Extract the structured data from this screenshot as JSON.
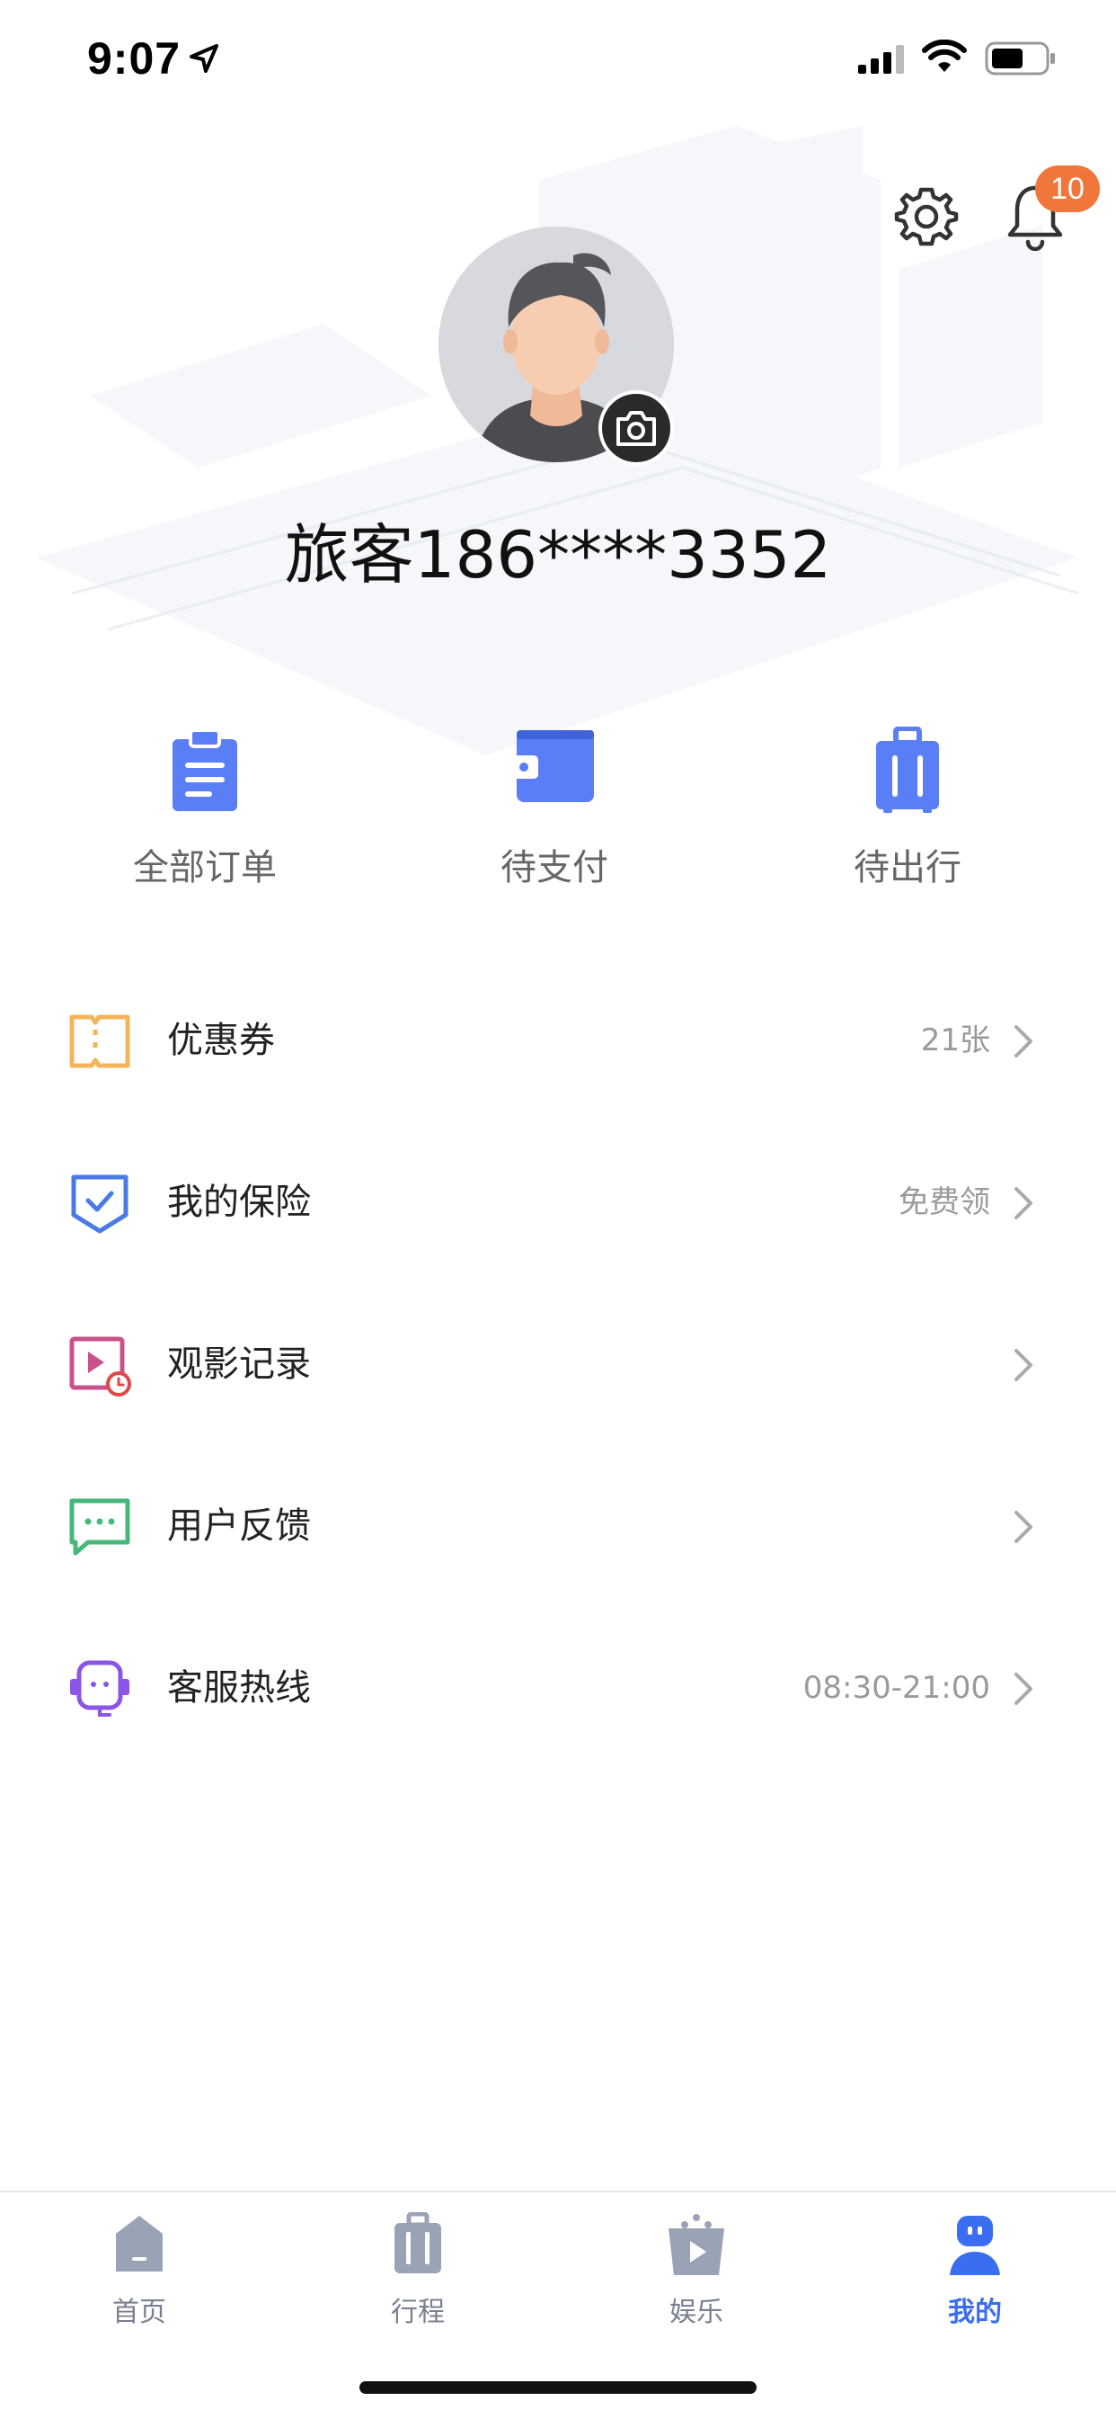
{
  "status_bar": {
    "time": "9:07"
  },
  "header": {
    "notification_count": "10"
  },
  "profile": {
    "username": "旅客186****3352"
  },
  "orders": [
    {
      "label": "全部订单",
      "icon": "clipboard-icon"
    },
    {
      "label": "待支付",
      "icon": "wallet-icon"
    },
    {
      "label": "待出行",
      "icon": "luggage-icon"
    }
  ],
  "menu": [
    {
      "label": "优惠券",
      "value": "21张",
      "icon": "coupon-icon"
    },
    {
      "label": "我的保险",
      "value": "免费领",
      "icon": "shield-icon"
    },
    {
      "label": "观影记录",
      "value": "",
      "icon": "video-history-icon"
    },
    {
      "label": "用户反馈",
      "value": "",
      "icon": "chat-icon"
    },
    {
      "label": "客服热线",
      "value": "08:30-21:00",
      "icon": "headset-icon"
    }
  ],
  "tabs": [
    {
      "label": "首页",
      "icon": "home-icon"
    },
    {
      "label": "行程",
      "icon": "trip-icon"
    },
    {
      "label": "娱乐",
      "icon": "entertainment-icon"
    },
    {
      "label": "我的",
      "icon": "profile-icon",
      "active": true
    }
  ],
  "colors": {
    "accent": "#3a6df0",
    "icon_blue": "#5a7ef5",
    "badge": "#f0763b",
    "coupon": "#f4b45a",
    "shield": "#4a79e8",
    "video": "#c8518a",
    "chat": "#46b87a",
    "headset": "#8b55e6",
    "tab_inactive": "#9aa3b5"
  }
}
